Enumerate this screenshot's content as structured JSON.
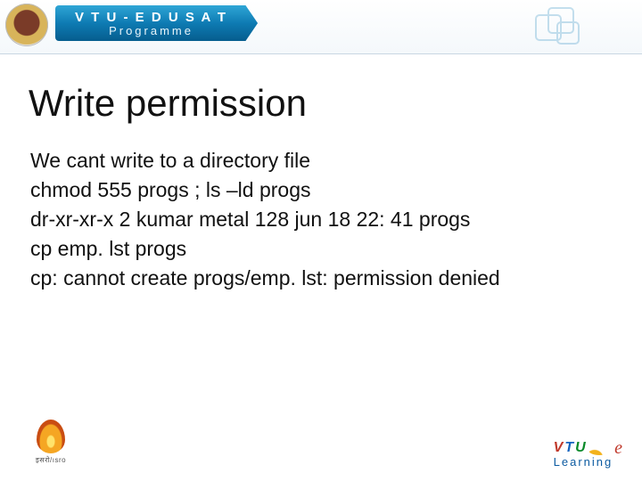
{
  "header": {
    "line1": "V T U  -  E D U S A T",
    "line2": "Programme"
  },
  "content": {
    "title": "Write permission",
    "lines": [
      "We cant write to a directory file",
      "chmod 555 progs ; ls –ld progs",
      "dr-xr-xr-x 2 kumar metal 128 jun 18 22: 41 progs",
      "cp emp. lst progs",
      "cp: cannot create progs/emp. lst: permission denied"
    ]
  },
  "footer": {
    "left_caption": "इसरो/ısro",
    "right_learning": "Learning"
  }
}
